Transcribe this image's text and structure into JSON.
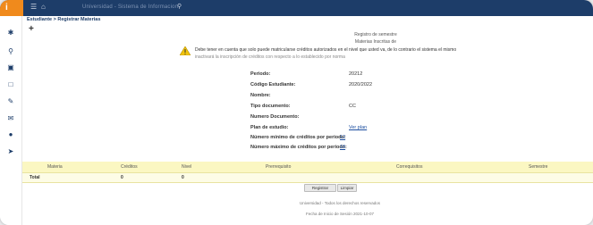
{
  "topbar": {
    "logo_letter": "i",
    "nav_text": "Universidad - Sistema de Informacion"
  },
  "breadcrumb": "Estudiante > Registrar Materias",
  "header": {
    "line1": "Registro de semestre",
    "line2": "Materias Inscritas de"
  },
  "warning": {
    "line1": "Debe tener en cuenta que solo puede matricularse créditos autorizados en el nivel que usted va, de lo contrario el sistema el mismo",
    "line2": "inactivará la inscripción de créditos con respecto a lo establecido por norma"
  },
  "fields": [
    {
      "label": "Periodo:",
      "value": "20212"
    },
    {
      "label": "Código Estudiante:",
      "value": "2020/2022"
    },
    {
      "label": "Nombre:",
      "value": ""
    },
    {
      "label": "Tipo documento:",
      "value": "CC"
    },
    {
      "label": "Numero Documento:",
      "value": ""
    },
    {
      "label": "Plan de estudio:",
      "value": "Ver plan"
    },
    {
      "label": "Número mínimo de créditos por periodo:",
      "value": "12"
    },
    {
      "label": "Número máximo de créditos por periodo:",
      "value": "18"
    }
  ],
  "table": {
    "headers": [
      "Materia",
      "Créditos",
      "Nivel",
      "Prerrequisito",
      "Correquisitos",
      "Semestre"
    ],
    "total_row": {
      "label": "Total",
      "credits": "0",
      "level": "0"
    }
  },
  "buttons": {
    "register": "Registrar",
    "clean": "Limpiar"
  },
  "footer": {
    "line1": "Universidad - Todos los derechos reservados",
    "line2": "Fecha de Inicio de Sesión 2021-10-07"
  }
}
